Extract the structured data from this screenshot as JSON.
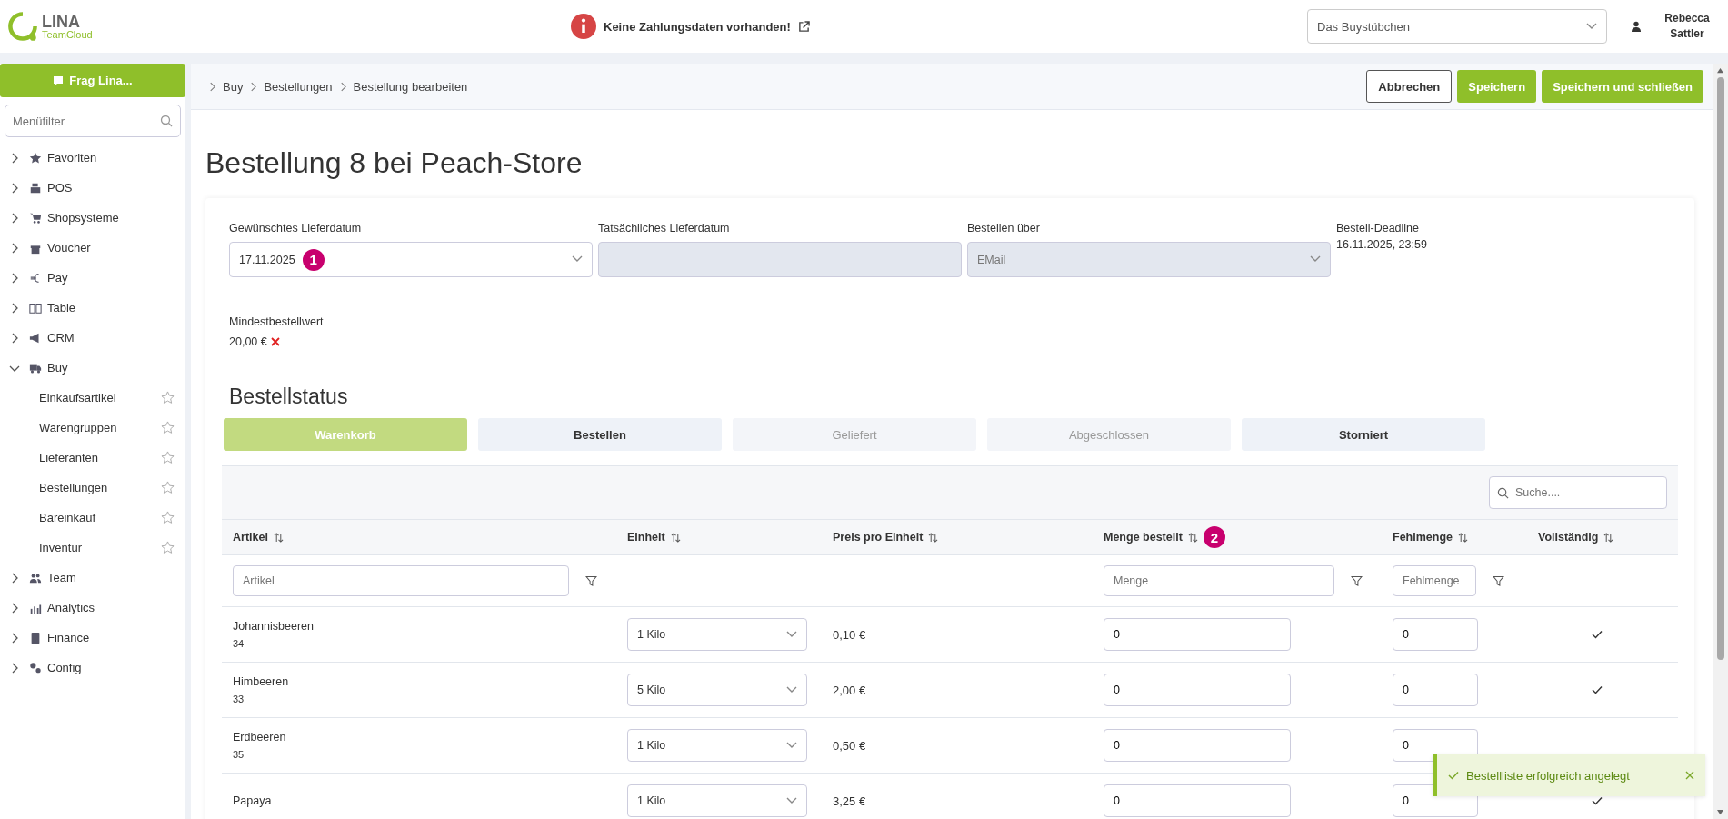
{
  "header": {
    "logo": {
      "name": "LINA",
      "subtitle": "TeamCloud"
    },
    "notice": "Keine Zahlungsdaten vorhanden!",
    "store_select": "Das Buystübchen",
    "user": "Rebecca Sattler"
  },
  "sidebar": {
    "ask_button": "Frag Lina...",
    "filter_placeholder": "Menüfilter",
    "items": [
      {
        "label": "Favoriten",
        "expanded": false
      },
      {
        "label": "POS",
        "expanded": false
      },
      {
        "label": "Shopsysteme",
        "expanded": false
      },
      {
        "label": "Voucher",
        "expanded": false
      },
      {
        "label": "Pay",
        "expanded": false
      },
      {
        "label": "Table",
        "expanded": false
      },
      {
        "label": "CRM",
        "expanded": false
      },
      {
        "label": "Buy",
        "expanded": true,
        "children": [
          {
            "label": "Einkaufsartikel",
            "favorite": false
          },
          {
            "label": "Warengruppen",
            "favorite": false
          },
          {
            "label": "Lieferanten",
            "favorite": false
          },
          {
            "label": "Bestellungen",
            "favorite": false
          },
          {
            "label": "Bareinkauf",
            "favorite": false
          },
          {
            "label": "Inventur",
            "favorite": false
          }
        ]
      },
      {
        "label": "Team",
        "expanded": false
      },
      {
        "label": "Analytics",
        "expanded": false
      },
      {
        "label": "Finance",
        "expanded": false
      },
      {
        "label": "Config",
        "expanded": false
      }
    ]
  },
  "breadcrumb": [
    "Buy",
    "Bestellungen",
    "Bestellung bearbeiten"
  ],
  "actions": [
    {
      "label": "Abbrechen",
      "kind": "secondary"
    },
    {
      "label": "Speichern",
      "kind": "primary"
    },
    {
      "label": "Speichern und schließen",
      "kind": "primary"
    }
  ],
  "title": "Bestellung 8 bei Peach-Store",
  "fields": [
    {
      "label": "Gewünschtes Lieferdatum",
      "kind": "select",
      "value": "17.11.2025",
      "disabled": false,
      "marker": "1"
    },
    {
      "label": "Tatsächliches Lieferdatum",
      "kind": "input",
      "disabled": true
    },
    {
      "label": "Bestellen über",
      "kind": "select",
      "value": "EMail",
      "disabled": true
    },
    {
      "label": "Bestell-Deadline",
      "kind": "text",
      "value": "16.11.2025, 23:59"
    }
  ],
  "min_order": {
    "label": "Mindestbestellwert",
    "value": "20,00 €",
    "met": false
  },
  "status": {
    "title": "Bestellstatus",
    "steps": [
      {
        "label": "Warenkorb",
        "selected": true,
        "disabled": false
      },
      {
        "label": "Bestellen",
        "selected": false,
        "disabled": false
      },
      {
        "label": "Geliefert",
        "selected": false,
        "disabled": true
      },
      {
        "label": "Abgeschlossen",
        "selected": false,
        "disabled": true
      },
      {
        "label": "Storniert",
        "selected": false,
        "disabled": false
      }
    ]
  },
  "table": {
    "search_placeholder": "Suche....",
    "columns": [
      {
        "label": "Artikel",
        "filter_placeholder": "Artikel"
      },
      {
        "label": "Einheit"
      },
      {
        "label": "Preis pro Einheit"
      },
      {
        "label": "Menge bestellt",
        "filter_placeholder": "Menge",
        "marker": "2"
      },
      {
        "label": "Fehlmenge",
        "filter_placeholder": "Fehlmenge"
      },
      {
        "label": "Vollständig"
      }
    ],
    "rows": [
      {
        "name": "Johannisbeeren",
        "id": "34",
        "unit": "1 Kilo",
        "price": "0,10 €",
        "ordered": "0",
        "missing": "0",
        "complete": true
      },
      {
        "name": "Himbeeren",
        "id": "33",
        "unit": "5 Kilo",
        "price": "2,00 €",
        "ordered": "0",
        "missing": "0",
        "complete": true
      },
      {
        "name": "Erdbeeren",
        "id": "35",
        "unit": "1 Kilo",
        "price": "0,50 €",
        "ordered": "0",
        "missing": "0"
      },
      {
        "name": "Papaya",
        "unit": "1 Kilo",
        "price": "3,25 €",
        "ordered": "0",
        "missing": "0",
        "complete": true
      }
    ]
  },
  "toast": {
    "message": "Bestellliste erfolgreich angelegt"
  }
}
